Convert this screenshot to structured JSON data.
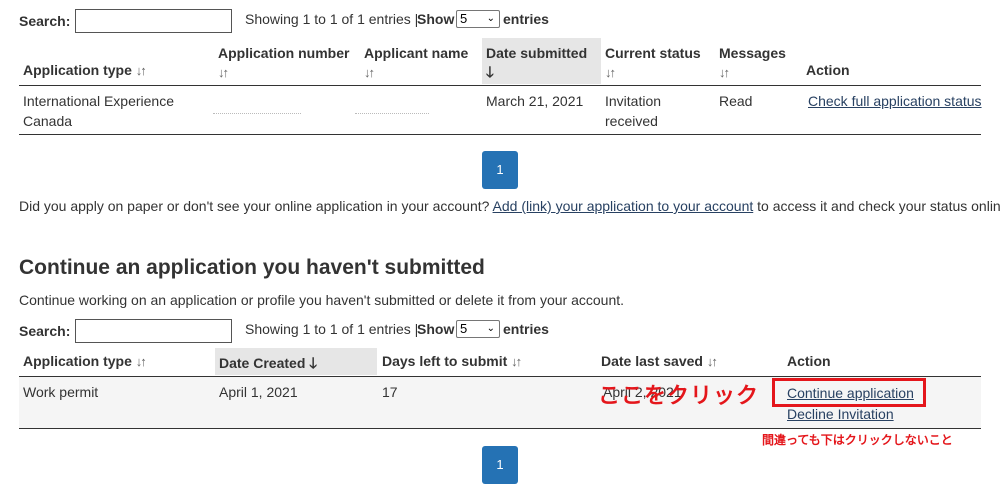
{
  "submitted_table": {
    "search_label": "Search:",
    "info": "Showing 1 to 1 of 1 entries |",
    "show_label": "Show",
    "show_value": "5",
    "entries_label": "entries",
    "headers": {
      "application_type": "Application type",
      "application_number": "Application number",
      "applicant_name": "Applicant name",
      "date_submitted": "Date submitted",
      "current_status": "Current status",
      "messages": "Messages",
      "action": "Action"
    },
    "row": {
      "application_type": "International Experience Canada",
      "date_submitted": "March 21, 2021",
      "current_status": "Invitation received",
      "messages": "Read",
      "action": "Check full application status"
    },
    "page": "1"
  },
  "link_note": {
    "before": "Did you apply on paper or don't see your online application in your account?",
    "link": "Add (link) your application to your account",
    "after": "to access it and check your status online."
  },
  "unsubmitted": {
    "heading": "Continue an application you haven't submitted",
    "description": "Continue working on an application or profile you haven't submitted or delete it from your account.",
    "search_label": "Search:",
    "info": "Showing 1 to 1 of 1 entries |",
    "show_label": "Show",
    "show_value": "5",
    "entries_label": "entries",
    "headers": {
      "application_type": "Application type",
      "date_created": "Date Created",
      "days_left": "Days left to submit",
      "date_last_saved": "Date last saved",
      "action": "Action"
    },
    "row": {
      "application_type": "Work permit",
      "date_created": "April 1, 2021",
      "days_left": "17",
      "date_last_saved": "April 2, 2021",
      "continue": "Continue application",
      "decline": "Decline Invitation"
    },
    "page": "1"
  },
  "annotations": {
    "click_here": "ここをクリック",
    "warning": "間違っても下はクリックしないこと",
    "color": "#e4161b"
  },
  "colors": {
    "pagination": "#2572b4",
    "link": "#284162",
    "sorted_header": "#e6e6e6"
  }
}
